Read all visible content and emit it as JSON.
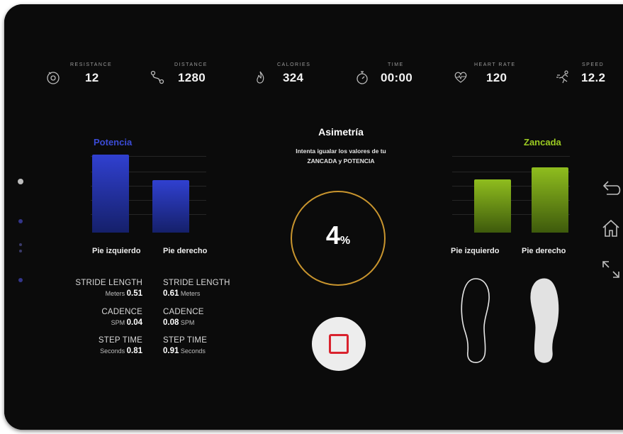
{
  "stats": [
    {
      "label": "RESISTANCE",
      "value": "12",
      "icon": "resistance-icon"
    },
    {
      "label": "DISTANCE",
      "value": "1280",
      "icon": "distance-icon"
    },
    {
      "label": "CALORIES",
      "value": "324",
      "icon": "flame-icon"
    },
    {
      "label": "TIME",
      "value": "00:00",
      "icon": "stopwatch-icon"
    },
    {
      "label": "HEART RATE",
      "value": "120",
      "icon": "heart-rate-icon"
    },
    {
      "label": "SPEED",
      "value": "12.2",
      "icon": "speed-runner-icon"
    }
  ],
  "left_chart": {
    "title": "Potencia",
    "color": "#2a38c4",
    "left_label": "Pie izquierdo",
    "right_label": "Pie derecho",
    "left_value": 1.0,
    "right_value": 0.67
  },
  "right_chart": {
    "title": "Zancada",
    "color": "#8fbf1f",
    "left_label": "Pie izquierdo",
    "right_label": "Pie derecho",
    "left_value": 0.81,
    "right_value": 1.0
  },
  "metrics": {
    "left": [
      {
        "title": "STRIDE LENGTH",
        "unit": "Meters",
        "value": "0.51"
      },
      {
        "title": "CADENCE",
        "unit": "SPM",
        "value": "0.04"
      },
      {
        "title": "STEP TIME",
        "unit": "Seconds",
        "value": "0.81"
      }
    ],
    "right": [
      {
        "title": "STRIDE LENGTH",
        "unit": "Meters",
        "value": "0.61"
      },
      {
        "title": "CADENCE",
        "unit": "SPM",
        "value": "0.08"
      },
      {
        "title": "STEP TIME",
        "unit": "Seconds",
        "value": "0.91"
      }
    ]
  },
  "center": {
    "title": "Asimetría",
    "subtitle_line1": "Intenta igualar los valores de tu",
    "subtitle_line2": "ZANCADA y POTENCIA",
    "percent": "4",
    "percent_symbol": "%",
    "ring_color": "#c9952e"
  },
  "nav": [
    "back-icon",
    "home-icon",
    "expand-icon"
  ],
  "colors": {
    "stop": "#d9232e",
    "background": "#0b0b0b"
  }
}
